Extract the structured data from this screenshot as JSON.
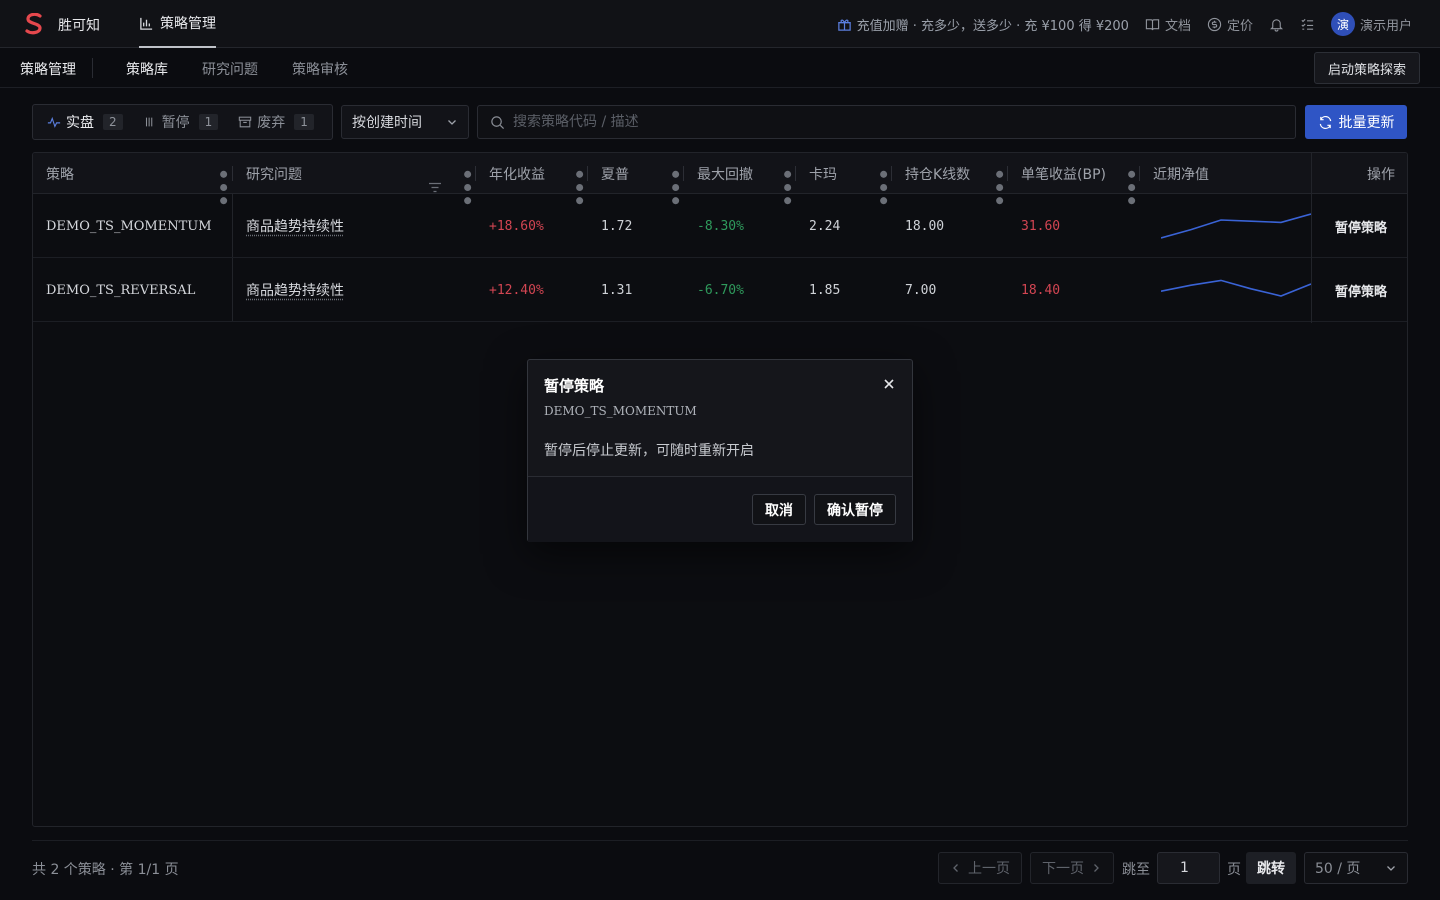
{
  "app": {
    "name": "胜可知",
    "nav_active": "策略管理"
  },
  "topbar": {
    "promo": "充值加赠 · 充多少，送多少 · 充 ¥100 得 ¥200",
    "docs": "文档",
    "pricing": "定价",
    "user_avatar": "演",
    "user_name": "演示用户"
  },
  "subnav": {
    "title": "策略管理",
    "tabs": [
      "策略库",
      "研究问题",
      "策略审核"
    ],
    "active_tab": "策略库",
    "launch_button": "启动策略探索"
  },
  "filters": {
    "status": [
      {
        "label": "实盘",
        "count": "2",
        "icon": "pulse-icon"
      },
      {
        "label": "暂停",
        "count": "1",
        "icon": "pause-icon"
      },
      {
        "label": "废弃",
        "count": "1",
        "icon": "archive-icon"
      }
    ],
    "sort_value": "按创建时间",
    "search_placeholder": "搜索策略代码 / 描述",
    "bulk_update": "批量更新"
  },
  "table": {
    "columns": [
      "策略",
      "研究问题",
      "年化收益",
      "夏普",
      "最大回撤",
      "卡玛",
      "持仓K线数",
      "单笔收益(BP)",
      "近期净值",
      "操作"
    ],
    "rows": [
      {
        "strategy": "DEMO_TS_MOMENTUM",
        "question": "商品趋势持续性",
        "annual_return": "+18.60%",
        "sharpe": "1.72",
        "max_drawdown": "-8.30%",
        "calmar": "2.24",
        "holding_bars": "18.00",
        "per_trade_bp": "31.60",
        "nav_trend": [
          0.0,
          0.35,
          0.75,
          0.7,
          0.65,
          1.0
        ],
        "action": "暂停策略"
      },
      {
        "strategy": "DEMO_TS_REVERSAL",
        "question": "商品趋势持续性",
        "annual_return": "+12.40%",
        "sharpe": "1.31",
        "max_drawdown": "-6.70%",
        "calmar": "1.85",
        "holding_bars": "7.00",
        "per_trade_bp": "18.40",
        "nav_trend": [
          0.45,
          0.7,
          0.9,
          0.55,
          0.25,
          0.75
        ],
        "action": "暂停策略"
      }
    ]
  },
  "footer": {
    "total": "共 2 个策略 · 第 1/1 页",
    "prev": "上一页",
    "next": "下一页",
    "jump_to": "跳至",
    "page_value": "1",
    "page_unit": "页",
    "jump_button": "跳转",
    "page_size": "50 / 页"
  },
  "modal": {
    "title": "暂停策略",
    "subtitle": "DEMO_TS_MOMENTUM",
    "description": "暂停后停止更新，可随时重新开启",
    "cancel": "取消",
    "confirm": "确认暂停"
  },
  "colors": {
    "accent": "#2f55c5",
    "positive": "#d24552",
    "negative": "#2f9a5c",
    "sparkline": "#3a63d6"
  }
}
